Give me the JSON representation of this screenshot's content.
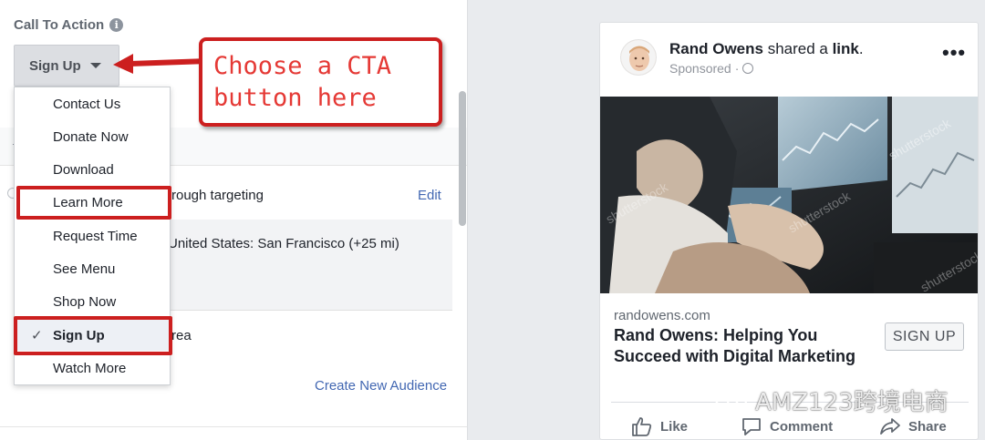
{
  "cta": {
    "heading": "Call To Action",
    "selected_value": "Sign Up",
    "options": [
      {
        "label": "Contact Us",
        "selected": false
      },
      {
        "label": "Donate Now",
        "selected": false
      },
      {
        "label": "Download",
        "selected": false
      },
      {
        "label": "Learn More",
        "selected": false
      },
      {
        "label": "Request Time",
        "selected": false
      },
      {
        "label": "See Menu",
        "selected": false
      },
      {
        "label": "Shop Now",
        "selected": false
      },
      {
        "label": "Sign Up",
        "selected": true
      },
      {
        "label": "Watch More",
        "selected": false
      }
    ]
  },
  "annotation": {
    "text": "Choose a CTA\nbutton here",
    "color": "#e53935",
    "border_color": "#cc1f1f"
  },
  "audience": {
    "targeting_text": "rough targeting",
    "edit_label": "Edit",
    "location_text": "United States: San Francisco (+25 mi)",
    "area_text": "rea",
    "create_audience_label": "Create New Audience"
  },
  "ad_preview": {
    "page_name": "Rand Owens",
    "shared_text": " shared a ",
    "link_word": "link",
    "period": ".",
    "sponsored": "Sponsored",
    "sponsored_sep": "·",
    "image_watermark": "shutterstock",
    "domain": "randowens.com",
    "headline": "Rand Owens: Helping You Succeed with Digital Marketing",
    "cta_button": "SIGN UP",
    "actions": {
      "like": "Like",
      "comment": "Comment",
      "share": "Share"
    }
  },
  "watermark": {
    "text": "AMZ123跨境电商"
  },
  "colors": {
    "link_blue": "#4267b2",
    "highlight_red": "#cc1f1f",
    "background": "#e9ebee"
  }
}
